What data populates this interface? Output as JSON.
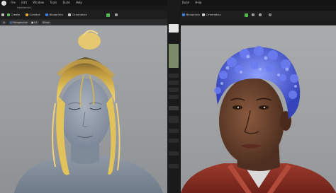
{
  "left_editor": {
    "menu": [
      "File",
      "Edit",
      "Window",
      "Tools",
      "Build",
      "Help"
    ],
    "project_tab": "HairDemo1",
    "toolbar": {
      "create": "Create",
      "content": "Content",
      "blueprints": "Blueprints",
      "cinematics": "Cinematics"
    },
    "viewport_bar": {
      "perspective": "Perspective",
      "lit": "Lit",
      "show": "Show"
    }
  },
  "right_editor": {
    "menu": [
      "Build",
      "Help"
    ],
    "toolbar": {
      "blueprints": "Blueprints",
      "cinematics": "Cinematics"
    }
  },
  "colors": {
    "accent_blue": "#3b7ddd",
    "hair_blonde": "#d9b64a",
    "hair_blue_curls": "#4a5bd3",
    "skin_grey": "#8a95a6",
    "skin_dark": "#5a3a2a",
    "shirt_red": "#8a2b22"
  },
  "icons": {
    "logo": "unreal-logo-icon",
    "create": "create-icon",
    "content": "content-icon",
    "blueprints": "blueprints-icon",
    "cinematics": "cinematics-icon",
    "play": "play-icon",
    "settings": "settings-icon"
  }
}
